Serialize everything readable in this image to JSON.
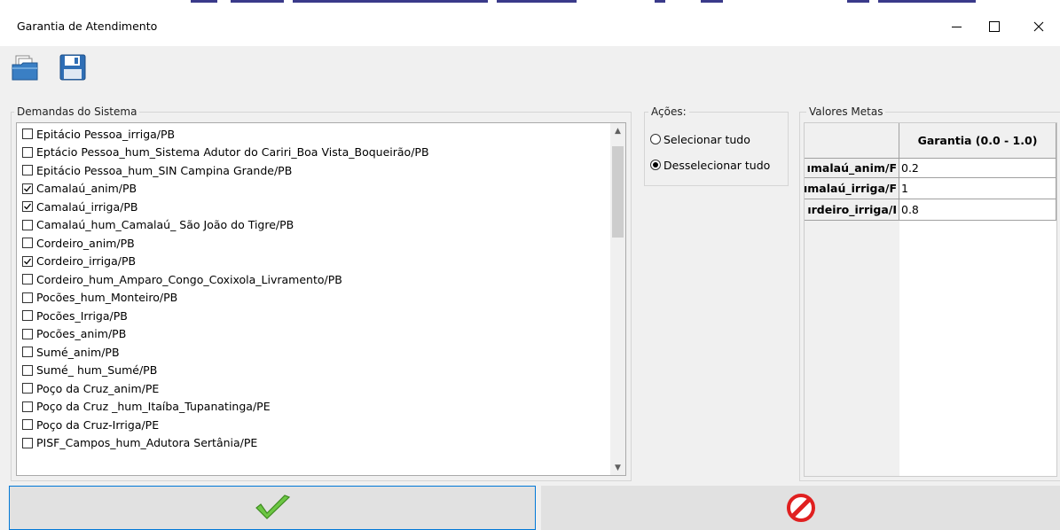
{
  "window": {
    "title": "Garantia de Atendimento"
  },
  "toolbar": {
    "open_icon": "open-folder-icon",
    "save_icon": "floppy-disk-icon"
  },
  "demandas": {
    "label": "Demandas do Sistema",
    "items": [
      {
        "label": "Epitácio Pessoa_irriga/PB",
        "checked": false
      },
      {
        "label": "Eptácio Pessoa_hum_Sistema Adutor do Cariri_Boa Vista_Boqueirão/PB",
        "checked": false
      },
      {
        "label": "Epitácio Pessoa_hum_SIN Campina Grande/PB",
        "checked": false
      },
      {
        "label": "Camalaú_anim/PB",
        "checked": true
      },
      {
        "label": "Camalaú_irriga/PB",
        "checked": true
      },
      {
        "label": "Camalaú_hum_Camalaú_ São João do Tigre/PB",
        "checked": false
      },
      {
        "label": "Cordeiro_anim/PB",
        "checked": false
      },
      {
        "label": "Cordeiro_irriga/PB",
        "checked": true
      },
      {
        "label": "Cordeiro_hum_Amparo_Congo_Coxixola_Livramento/PB",
        "checked": false
      },
      {
        "label": "Pocões_hum_Monteiro/PB",
        "checked": false
      },
      {
        "label": "Pocões_Irriga/PB",
        "checked": false
      },
      {
        "label": "Pocões_anim/PB",
        "checked": false
      },
      {
        "label": "Sumé_anim/PB",
        "checked": false
      },
      {
        "label": "Sumé_ hum_Sumé/PB",
        "checked": false
      },
      {
        "label": "Poço da Cruz_anim/PE",
        "checked": false
      },
      {
        "label": "Poço da Cruz _hum_Itaíba_Tupanatinga/PE",
        "checked": false
      },
      {
        "label": "Poço da Cruz-Irriga/PE",
        "checked": false
      },
      {
        "label": "PISF_Campos_hum_Adutora Sertânia/PE",
        "checked": false
      }
    ]
  },
  "acoes": {
    "label": "Ações:",
    "options": [
      {
        "label": "Selecionar tudo",
        "selected": false
      },
      {
        "label": "Desselecionar tudo",
        "selected": true
      }
    ]
  },
  "metas": {
    "label": "Valores Metas",
    "column_header": "Garantia (0.0 - 1.0)",
    "rows": [
      {
        "name": "ımalaú_anim/F",
        "value": "0.2"
      },
      {
        "name": "ımalaú_irriga/F",
        "value": "1"
      },
      {
        "name": "ırdeiro_irriga/I",
        "value": "0.8"
      }
    ]
  },
  "buttons": {
    "ok_icon": "green-checkmark-icon",
    "cancel_icon": "red-cancel-icon"
  },
  "colors": {
    "accent": "#0078d7",
    "check_green": "#5cbf2a",
    "cancel_red": "#e02020"
  }
}
